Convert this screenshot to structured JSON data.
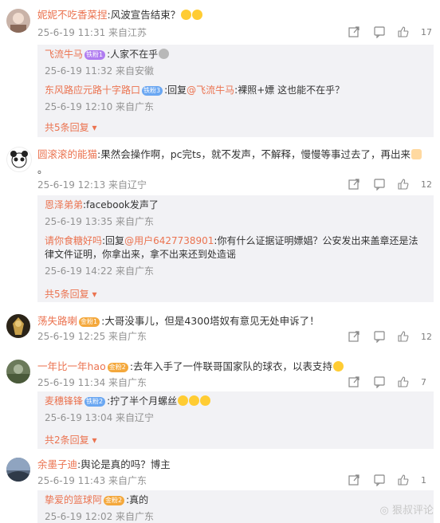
{
  "comments": [
    {
      "user": "妮妮不吃香菜捏",
      "text": ":风波宣告结束？",
      "meta": "25-6-19 11:31 来自江苏",
      "likes": "17",
      "replies": [
        {
          "user": "飞流牛马",
          "badge": "铁粉1",
          "text": ":人家不在乎",
          "meta": "25-6-19 11:32 来自安徽"
        },
        {
          "user": "东风路应元路十字路口",
          "badge": "铁粉3",
          "text": ":回复",
          "mention": "@飞流牛马",
          "text2": ":裸照+嫖 这也能不在乎？",
          "meta": "25-6-19 12:10 来自广东"
        }
      ],
      "more": "共5条回复"
    },
    {
      "user": "圆滚滚的能猫",
      "text": ":果然会操作啊，pc完ts，就不发声，不解释，慢慢等事过去了，再出来",
      "text_line2": "。",
      "meta": "25-6-19 12:13 来自辽宁",
      "likes": "12",
      "replies": [
        {
          "user": "恩泽弟弟",
          "text": ":facebook发声了",
          "meta": "25-6-19 13:35 来自广东"
        },
        {
          "user": "请你食糖好吗",
          "text": ":回复",
          "mention": "@用户6427738901",
          "text2": ":你有什么证据证明嫖娼？公安发出来盖章还是法律文件证明，你拿出来，拿不出来还到处造谣",
          "meta": "25-6-19 14:22 来自广东"
        }
      ],
      "more": "共5条回复"
    },
    {
      "user": "荡失路喇",
      "badge": "金粉1",
      "text": ":大哥没事儿，但是4300塔奴有意见无处申诉了！",
      "meta": "25-6-19 12:25 来自广东",
      "likes": "12"
    },
    {
      "user": "一年比一年hao",
      "badge": "金粉2",
      "text": ":去年入手了一件联哥国家队的球衣，以表支持",
      "meta": "25-6-19 11:34 来自广东",
      "likes": "7",
      "replies": [
        {
          "user": "麦穗锋锋",
          "badge": "铁粉2",
          "text": ":拧了半个月螺丝",
          "meta": "25-6-19 13:04 来自辽宁"
        }
      ],
      "more": "共2条回复"
    },
    {
      "user": "余墨子迪",
      "text": ":舆论是真的吗？博主",
      "meta": "25-6-19 11:43 来自广东",
      "likes": "1",
      "replies": [
        {
          "user": "挚爱的篮球阿",
          "badge": "金粉2",
          "text": ":真的",
          "meta": "25-6-19 12:02 来自广东"
        }
      ]
    }
  ],
  "watermark": "狠叔评论",
  "colors": {
    "name": "#eb7350",
    "reply_bg": "#f2f2f5",
    "meta": "#939393"
  }
}
